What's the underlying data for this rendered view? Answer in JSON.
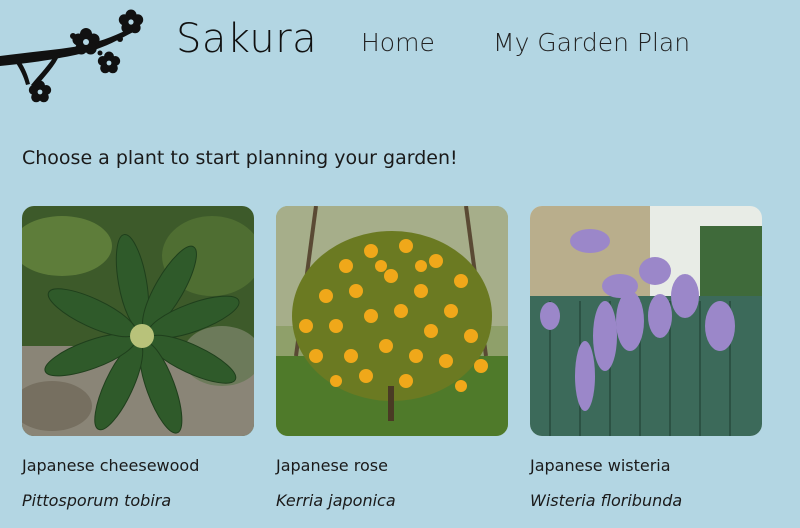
{
  "header": {
    "logo_icon": "cherry-blossom-branch-icon",
    "brand": "Sakura",
    "nav": [
      {
        "label": "Home"
      },
      {
        "label": "My Garden Plan"
      }
    ]
  },
  "intro": "Choose a plant to start planning your garden!",
  "plants": [
    {
      "common_name": "Japanese cheesewood",
      "latin_name": "Pittosporum tobira",
      "image": "cheesewood-photo"
    },
    {
      "common_name": "Japanese rose",
      "latin_name": "Kerria japonica",
      "image": "kerria-photo"
    },
    {
      "common_name": "Japanese wisteria",
      "latin_name": "Wisteria floribunda",
      "image": "wisteria-photo"
    }
  ],
  "colors": {
    "background": "#b3d6e3",
    "text": "#111111"
  }
}
